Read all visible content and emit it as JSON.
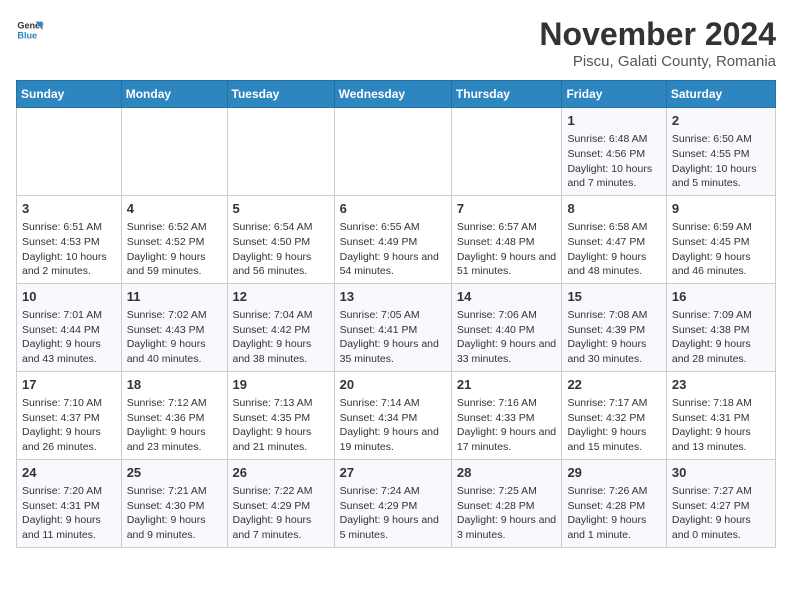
{
  "logo": {
    "name_part1": "General",
    "name_part2": "Blue"
  },
  "title": "November 2024",
  "subtitle": "Piscu, Galati County, Romania",
  "days_of_week": [
    "Sunday",
    "Monday",
    "Tuesday",
    "Wednesday",
    "Thursday",
    "Friday",
    "Saturday"
  ],
  "weeks": [
    [
      {
        "day": "",
        "info": ""
      },
      {
        "day": "",
        "info": ""
      },
      {
        "day": "",
        "info": ""
      },
      {
        "day": "",
        "info": ""
      },
      {
        "day": "",
        "info": ""
      },
      {
        "day": "1",
        "info": "Sunrise: 6:48 AM\nSunset: 4:56 PM\nDaylight: 10 hours and 7 minutes."
      },
      {
        "day": "2",
        "info": "Sunrise: 6:50 AM\nSunset: 4:55 PM\nDaylight: 10 hours and 5 minutes."
      }
    ],
    [
      {
        "day": "3",
        "info": "Sunrise: 6:51 AM\nSunset: 4:53 PM\nDaylight: 10 hours and 2 minutes."
      },
      {
        "day": "4",
        "info": "Sunrise: 6:52 AM\nSunset: 4:52 PM\nDaylight: 9 hours and 59 minutes."
      },
      {
        "day": "5",
        "info": "Sunrise: 6:54 AM\nSunset: 4:50 PM\nDaylight: 9 hours and 56 minutes."
      },
      {
        "day": "6",
        "info": "Sunrise: 6:55 AM\nSunset: 4:49 PM\nDaylight: 9 hours and 54 minutes."
      },
      {
        "day": "7",
        "info": "Sunrise: 6:57 AM\nSunset: 4:48 PM\nDaylight: 9 hours and 51 minutes."
      },
      {
        "day": "8",
        "info": "Sunrise: 6:58 AM\nSunset: 4:47 PM\nDaylight: 9 hours and 48 minutes."
      },
      {
        "day": "9",
        "info": "Sunrise: 6:59 AM\nSunset: 4:45 PM\nDaylight: 9 hours and 46 minutes."
      }
    ],
    [
      {
        "day": "10",
        "info": "Sunrise: 7:01 AM\nSunset: 4:44 PM\nDaylight: 9 hours and 43 minutes."
      },
      {
        "day": "11",
        "info": "Sunrise: 7:02 AM\nSunset: 4:43 PM\nDaylight: 9 hours and 40 minutes."
      },
      {
        "day": "12",
        "info": "Sunrise: 7:04 AM\nSunset: 4:42 PM\nDaylight: 9 hours and 38 minutes."
      },
      {
        "day": "13",
        "info": "Sunrise: 7:05 AM\nSunset: 4:41 PM\nDaylight: 9 hours and 35 minutes."
      },
      {
        "day": "14",
        "info": "Sunrise: 7:06 AM\nSunset: 4:40 PM\nDaylight: 9 hours and 33 minutes."
      },
      {
        "day": "15",
        "info": "Sunrise: 7:08 AM\nSunset: 4:39 PM\nDaylight: 9 hours and 30 minutes."
      },
      {
        "day": "16",
        "info": "Sunrise: 7:09 AM\nSunset: 4:38 PM\nDaylight: 9 hours and 28 minutes."
      }
    ],
    [
      {
        "day": "17",
        "info": "Sunrise: 7:10 AM\nSunset: 4:37 PM\nDaylight: 9 hours and 26 minutes."
      },
      {
        "day": "18",
        "info": "Sunrise: 7:12 AM\nSunset: 4:36 PM\nDaylight: 9 hours and 23 minutes."
      },
      {
        "day": "19",
        "info": "Sunrise: 7:13 AM\nSunset: 4:35 PM\nDaylight: 9 hours and 21 minutes."
      },
      {
        "day": "20",
        "info": "Sunrise: 7:14 AM\nSunset: 4:34 PM\nDaylight: 9 hours and 19 minutes."
      },
      {
        "day": "21",
        "info": "Sunrise: 7:16 AM\nSunset: 4:33 PM\nDaylight: 9 hours and 17 minutes."
      },
      {
        "day": "22",
        "info": "Sunrise: 7:17 AM\nSunset: 4:32 PM\nDaylight: 9 hours and 15 minutes."
      },
      {
        "day": "23",
        "info": "Sunrise: 7:18 AM\nSunset: 4:31 PM\nDaylight: 9 hours and 13 minutes."
      }
    ],
    [
      {
        "day": "24",
        "info": "Sunrise: 7:20 AM\nSunset: 4:31 PM\nDaylight: 9 hours and 11 minutes."
      },
      {
        "day": "25",
        "info": "Sunrise: 7:21 AM\nSunset: 4:30 PM\nDaylight: 9 hours and 9 minutes."
      },
      {
        "day": "26",
        "info": "Sunrise: 7:22 AM\nSunset: 4:29 PM\nDaylight: 9 hours and 7 minutes."
      },
      {
        "day": "27",
        "info": "Sunrise: 7:24 AM\nSunset: 4:29 PM\nDaylight: 9 hours and 5 minutes."
      },
      {
        "day": "28",
        "info": "Sunrise: 7:25 AM\nSunset: 4:28 PM\nDaylight: 9 hours and 3 minutes."
      },
      {
        "day": "29",
        "info": "Sunrise: 7:26 AM\nSunset: 4:28 PM\nDaylight: 9 hours and 1 minute."
      },
      {
        "day": "30",
        "info": "Sunrise: 7:27 AM\nSunset: 4:27 PM\nDaylight: 9 hours and 0 minutes."
      }
    ]
  ]
}
